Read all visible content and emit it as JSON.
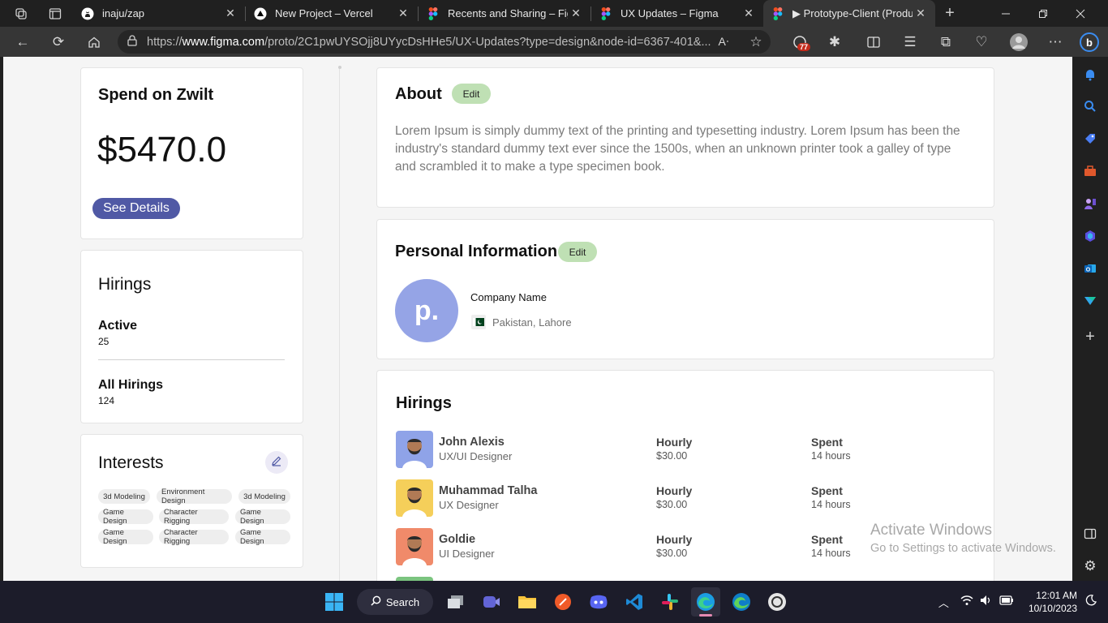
{
  "browser": {
    "tabs": [
      {
        "title": "inaju/zap",
        "icon": "github-icon"
      },
      {
        "title": "New Project – Vercel",
        "icon": "vercel-icon"
      },
      {
        "title": "Recents and Sharing – Figm",
        "icon": "figma-icon"
      },
      {
        "title": "UX Updates – Figma",
        "icon": "figma-icon"
      },
      {
        "title": "▶ Prototype-Client (Produc",
        "icon": "figma-icon"
      }
    ],
    "url_prefix": "https://",
    "url_host": "www.figma.com",
    "url_rest": "/proto/2C1pwUYSOjj8UYycDsHHe5/UX-Updates?type=design&node-id=6367-401&...",
    "extension_badge": "77"
  },
  "spend": {
    "title": "Spend on Zwilt",
    "amount": "$5470.0",
    "button": "See Details"
  },
  "hirings_summary": {
    "title": "Hirings",
    "active_label": "Active",
    "active_value": "25",
    "all_label": "All Hirings",
    "all_value": "124"
  },
  "interests": {
    "title": "Interests",
    "chips": [
      "3d Modeling",
      "Environment Design",
      "3d Modeling",
      "Game Design",
      "Character Rigging",
      "Game Design",
      "Game Design",
      "Character Rigging",
      "Game Design"
    ]
  },
  "about": {
    "title": "About",
    "edit": "Edit",
    "text": "Lorem Ipsum is simply dummy text of the printing and typesetting industry. Lorem Ipsum has been the industry's standard dummy text ever since the 1500s, when an unknown printer took a galley of type and scrambled it to make a type specimen book."
  },
  "personal": {
    "title": "Personal Information",
    "edit": "Edit",
    "logo_text": "p.",
    "company": "Company Name",
    "location": "Pakistan, Lahore"
  },
  "hirings_list": {
    "title": "Hirings",
    "rows": [
      {
        "name": "John Alexis",
        "role": "UX/UI Designer",
        "rate_label": "Hourly",
        "rate": "$30.00",
        "spent_label": "Spent",
        "spent": "14 hours",
        "bg": "#8fa3e8"
      },
      {
        "name": "Muhammad Talha",
        "role": "UX Designer",
        "rate_label": "Hourly",
        "rate": "$30.00",
        "spent_label": "Spent",
        "spent": "14 hours",
        "bg": "#f5cf5a"
      },
      {
        "name": "Goldie",
        "role": "UI Designer",
        "rate_label": "Hourly",
        "rate": "$30.00",
        "spent_label": "Spent",
        "spent": "14 hours",
        "bg": "#f08a6a"
      }
    ]
  },
  "watermark": {
    "line1": "Activate Windows",
    "line2": "Go to Settings to activate Windows."
  },
  "taskbar": {
    "search": "Search",
    "time": "12:01 AM",
    "date": "10/10/2023"
  },
  "colors": {
    "accent_button": "#5059a5",
    "edit_badge": "#bfe0b4",
    "logo_circle": "#95a4e6"
  }
}
